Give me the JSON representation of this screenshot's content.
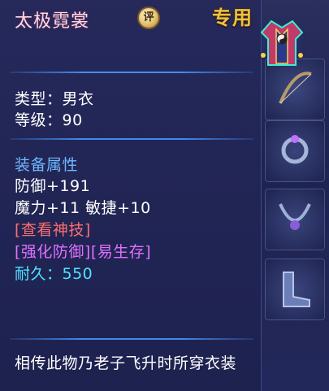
{
  "item": {
    "name": "太极霓裳",
    "rate_label": "评",
    "exclusive_label": "专用",
    "icon": "robe-armor-icon"
  },
  "basic": {
    "type_label": "类型：男衣",
    "level_label": "等级：90"
  },
  "attributes": {
    "heading": "装备属性",
    "defense": "防御+191",
    "stats": "魔力+11 敏捷+10",
    "skill_link": "[查看神技]",
    "special_effects": "[强化防御][易生存]",
    "durability": "耐久：550"
  },
  "description": "相传此物乃老子飞升时所穿衣装",
  "colors": {
    "title": "#ffd9e8",
    "exclusive": "#f0c040",
    "heading": "#6fb7ff",
    "skill_link": "#ff6e6e",
    "special": "#e070ff",
    "durability": "#4fe3ff"
  }
}
